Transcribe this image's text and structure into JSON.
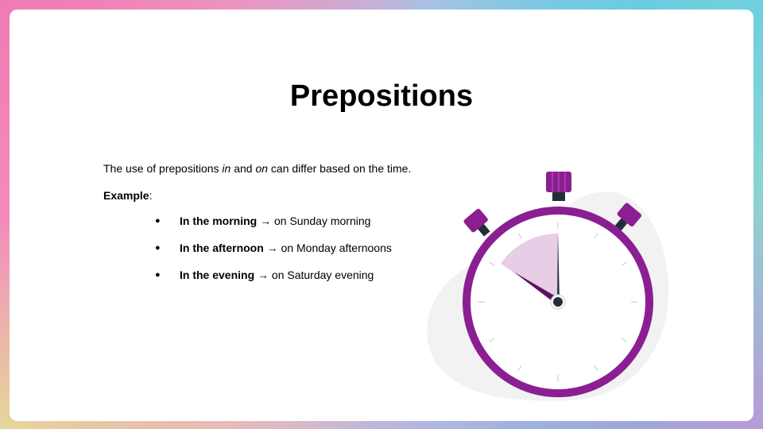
{
  "slide": {
    "title": "Prepositions",
    "intro": {
      "before": "The use of prepositions ",
      "word1": "in",
      "middle": " and ",
      "word2": "on",
      "after": " can differ based on the time."
    },
    "example_label": "Example",
    "example_colon": ":",
    "bullet_glyph": "●",
    "items": [
      {
        "term": "In the morning",
        "arrow": " → ",
        "rest": "on Sunday morning"
      },
      {
        "term": "In the afternoon",
        "arrow": " → ",
        "rest": "on Monday afternoons"
      },
      {
        "term": "In the evening",
        "arrow": " → ",
        "rest": "on Saturday evening"
      }
    ]
  },
  "illustration": {
    "icon": "stopwatch-icon",
    "colors": {
      "ring": "#8b1f91",
      "ring_light": "#a53aa9",
      "wedge": "#e8cde6",
      "hand": "#222f3a",
      "backdrop": "#f2f2f2"
    }
  }
}
